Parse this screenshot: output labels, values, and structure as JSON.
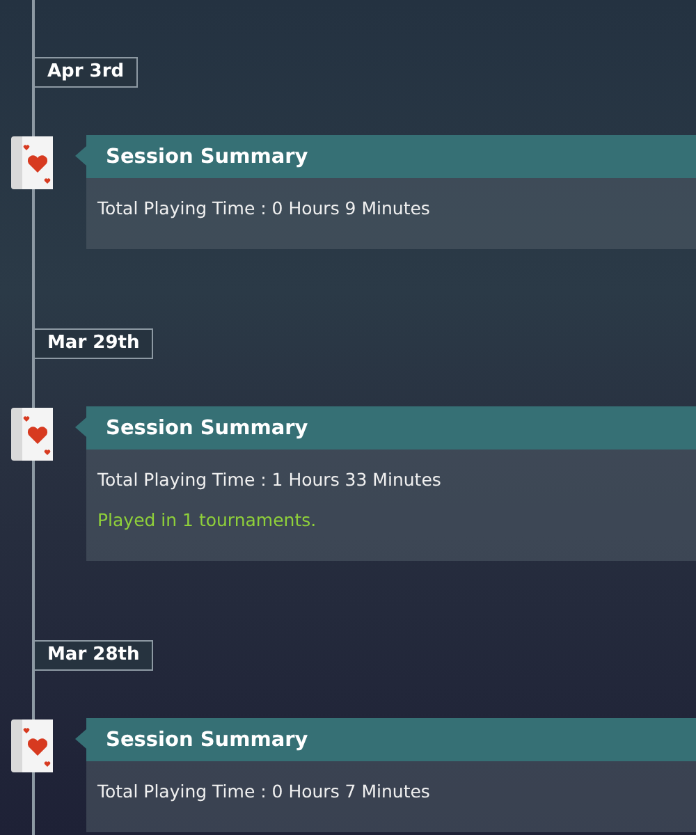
{
  "entries": [
    {
      "date": "Apr 3rd",
      "title": "Session Summary",
      "lines": [
        {
          "kind": "time",
          "text": "Total Playing Time : 0 Hours 9 Minutes"
        }
      ]
    },
    {
      "date": "Mar 29th",
      "title": "Session Summary",
      "lines": [
        {
          "kind": "time",
          "text": "Total Playing Time : 1 Hours 33 Minutes"
        },
        {
          "kind": "note",
          "text": "Played in 1 tournaments."
        }
      ]
    },
    {
      "date": "Mar 28th",
      "title": "Session Summary",
      "lines": [
        {
          "kind": "time",
          "text": "Total Playing Time : 0 Hours 7 Minutes"
        }
      ]
    }
  ]
}
